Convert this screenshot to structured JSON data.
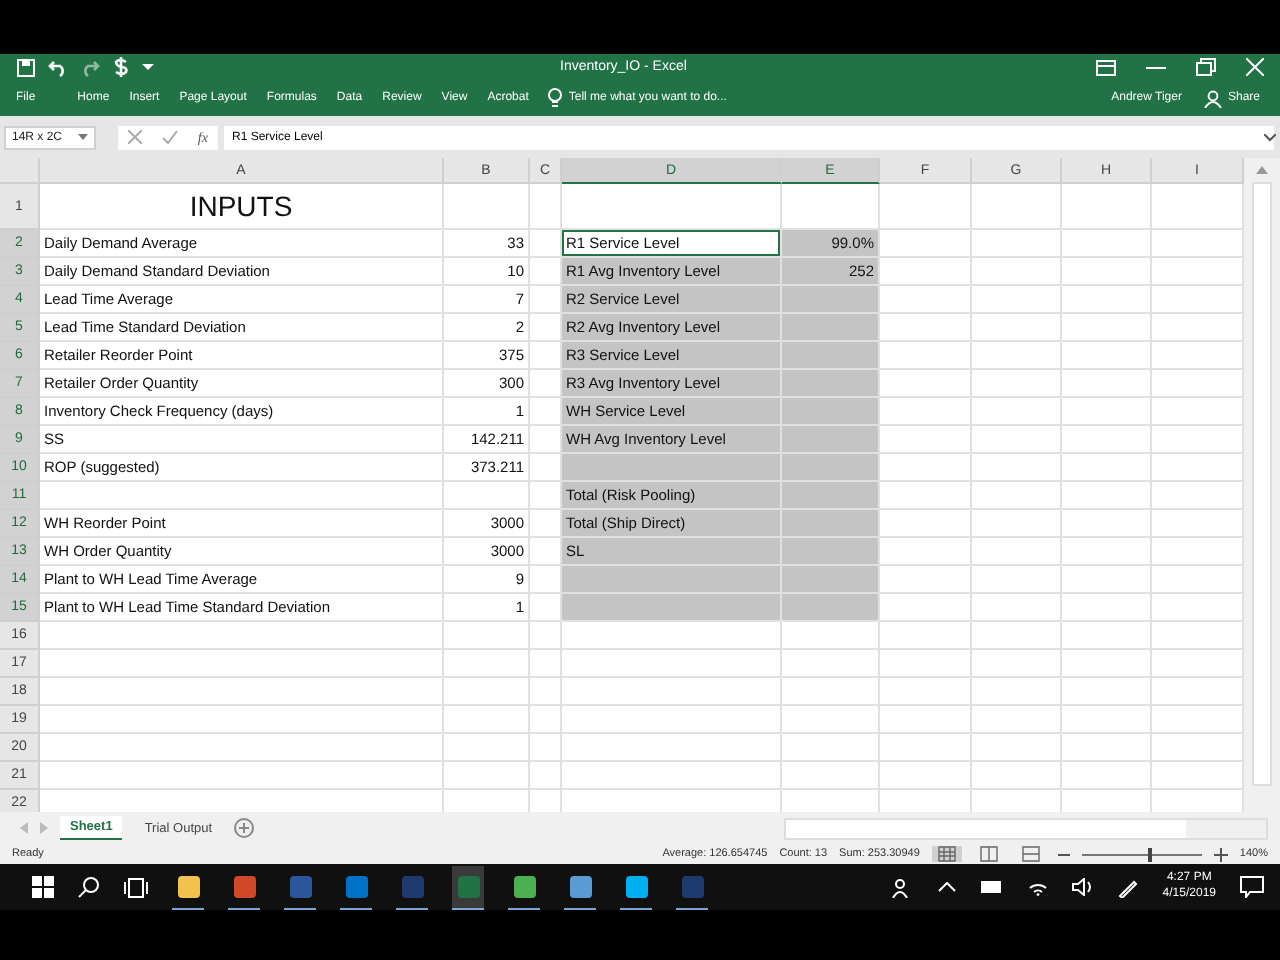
{
  "window": {
    "title": "Inventory_IO - Excel"
  },
  "ribbon": {
    "tabs": [
      "File",
      "Home",
      "Insert",
      "Page Layout",
      "Formulas",
      "Data",
      "Review",
      "View",
      "Acrobat"
    ],
    "tell_me": "Tell me what you want to do...",
    "user": "Andrew Tiger",
    "share": "Share"
  },
  "formula_bar": {
    "name_box": "14R x 2C",
    "function_label": "fx",
    "value": "R1 Service Level"
  },
  "columns": [
    {
      "label": "A",
      "selected": false
    },
    {
      "label": "B",
      "selected": false
    },
    {
      "label": "C",
      "selected": false
    },
    {
      "label": "D",
      "selected": true
    },
    {
      "label": "E",
      "selected": true
    },
    {
      "label": "F",
      "selected": false
    },
    {
      "label": "G",
      "selected": false
    },
    {
      "label": "H",
      "selected": false
    },
    {
      "label": "I",
      "selected": false
    }
  ],
  "rows": [
    {
      "num": "1",
      "kind": "title",
      "selected": false,
      "a": "INPUTS"
    },
    {
      "num": "2",
      "kind": "data",
      "selected": true,
      "a": "Daily Demand Average",
      "b": "33",
      "d": {
        "text": "R1 Service Level",
        "selected": true,
        "active": true
      },
      "e": {
        "text": "99.0%",
        "selected": true,
        "active": false
      }
    },
    {
      "num": "3",
      "kind": "data",
      "selected": true,
      "a": "Daily Demand Standard Deviation",
      "b": "10",
      "d": {
        "text": "R1 Avg Inventory Level",
        "selected": true,
        "active": false
      },
      "e": {
        "text": "252",
        "selected": true,
        "active": false
      }
    },
    {
      "num": "4",
      "kind": "data",
      "selected": true,
      "a": "Lead Time Average",
      "b": "7",
      "d": {
        "text": "R2 Service Level",
        "selected": true,
        "active": false
      },
      "e": {
        "selected": true,
        "active": false
      }
    },
    {
      "num": "5",
      "kind": "data",
      "selected": true,
      "a": "Lead Time Standard Deviation",
      "b": "2",
      "d": {
        "text": "R2 Avg Inventory Level",
        "selected": true,
        "active": false
      },
      "e": {
        "selected": true,
        "active": false
      }
    },
    {
      "num": "6",
      "kind": "data",
      "selected": true,
      "a": "Retailer Reorder Point",
      "b": "375",
      "d": {
        "text": "R3 Service Level",
        "selected": true,
        "active": false
      },
      "e": {
        "selected": true,
        "active": false
      }
    },
    {
      "num": "7",
      "kind": "data",
      "selected": true,
      "a": "Retailer Order Quantity",
      "b": "300",
      "d": {
        "text": "R3 Avg Inventory Level",
        "selected": true,
        "active": false
      },
      "e": {
        "selected": true,
        "active": false
      }
    },
    {
      "num": "8",
      "kind": "data",
      "selected": true,
      "a": "Inventory Check Frequency (days)",
      "b": "1",
      "d": {
        "text": "WH Service Level",
        "selected": true,
        "active": false
      },
      "e": {
        "selected": true,
        "active": false
      }
    },
    {
      "num": "9",
      "kind": "data",
      "selected": true,
      "a": "SS",
      "b": "142.211",
      "d": {
        "text": "WH Avg Inventory Level",
        "selected": true,
        "active": false
      },
      "e": {
        "selected": true,
        "active": false
      }
    },
    {
      "num": "10",
      "kind": "data",
      "selected": true,
      "a": "ROP (suggested)",
      "b": "373.211",
      "d": {
        "selected": true,
        "active": false
      },
      "e": {
        "selected": true,
        "active": false
      }
    },
    {
      "num": "11",
      "kind": "data",
      "selected": true,
      "d": {
        "text": "Total (Risk Pooling)",
        "selected": true,
        "active": false
      },
      "e": {
        "selected": true,
        "active": false
      }
    },
    {
      "num": "12",
      "kind": "data",
      "selected": true,
      "a": "WH Reorder Point",
      "b": "3000",
      "d": {
        "text": "Total (Ship Direct)",
        "selected": true,
        "active": false
      },
      "e": {
        "selected": true,
        "active": false
      }
    },
    {
      "num": "13",
      "kind": "data",
      "selected": true,
      "a": "WH Order Quantity",
      "b": "3000",
      "d": {
        "text": "SL",
        "selected": true,
        "active": false
      },
      "e": {
        "selected": true,
        "active": false
      }
    },
    {
      "num": "14",
      "kind": "data",
      "selected": true,
      "a": "Plant to WH Lead Time Average",
      "b": "9",
      "d": {
        "selected": true,
        "active": false
      },
      "e": {
        "selected": true,
        "active": false
      }
    },
    {
      "num": "15",
      "kind": "data",
      "selected": true,
      "a": "Plant to WH Lead Time Standard Deviation",
      "b": "1",
      "d": {
        "selected": true,
        "active": false
      },
      "e": {
        "selected": true,
        "active": false
      }
    },
    {
      "num": "16",
      "kind": "data",
      "selected": false
    },
    {
      "num": "17",
      "kind": "data",
      "selected": false
    },
    {
      "num": "18",
      "kind": "data",
      "selected": false
    },
    {
      "num": "19",
      "kind": "data",
      "selected": false
    },
    {
      "num": "20",
      "kind": "data",
      "selected": false
    },
    {
      "num": "21",
      "kind": "data",
      "selected": false
    },
    {
      "num": "22",
      "kind": "data",
      "selected": false
    }
  ],
  "sheet_tabs": [
    {
      "label": "Sheet1",
      "selected": true
    },
    {
      "label": "Trial Output",
      "selected": false
    }
  ],
  "status_bar": {
    "mode": "Ready",
    "average": "Average: 126.654745",
    "count": "Count: 13",
    "sum": "Sum: 253.30949",
    "zoom": {
      "level": 0.55,
      "reading": "140%"
    }
  },
  "taskbar": {
    "apps": [
      {
        "kind": "folder",
        "active": false
      },
      {
        "kind": "slides",
        "active": false
      },
      {
        "kind": "doc",
        "active": false
      },
      {
        "kind": "mail",
        "active": false
      },
      {
        "kind": "app",
        "active": false
      },
      {
        "kind": "sheet",
        "active": true
      },
      {
        "kind": "browser",
        "active": false
      },
      {
        "kind": "window",
        "active": false
      },
      {
        "kind": "chat",
        "active": false
      },
      {
        "kind": "app",
        "active": false
      }
    ],
    "time": "4:27 PM",
    "date": "4/15/2019"
  }
}
